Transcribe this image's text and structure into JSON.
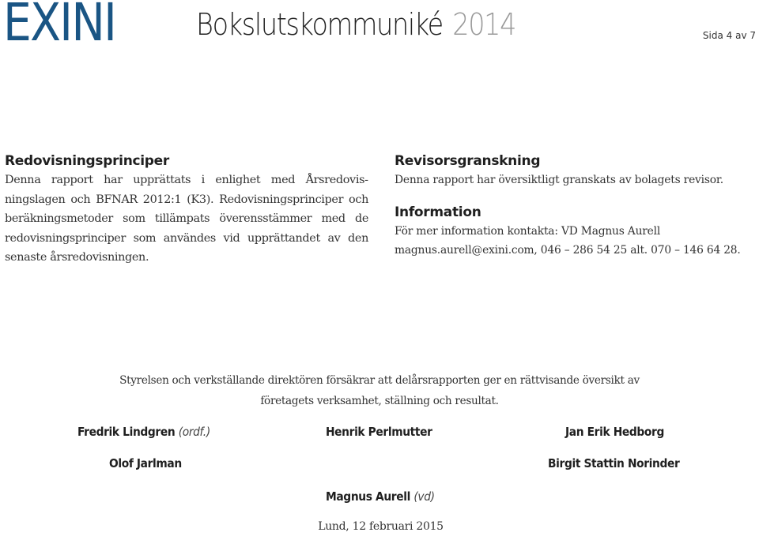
{
  "header": {
    "logo_text": "EXINI",
    "logo_color": "#1a5584",
    "document_title": "Bokslutskommuniké",
    "document_year": "2014",
    "page_indicator": "Sida 4 av 7"
  },
  "sections": {
    "accounting_principles": {
      "heading": "Redovisningsprinciper",
      "body": "Denna rapport har upprättats i enlighet med Årsredovis­ningslagen och BFNAR 2012:1 (K3). Redovisningsprinciper och beräkningsmetoder som tillämpats överensstämmer med de redovisningsprinciper som användes vid upprättandet av den senaste årsredovisningen."
    },
    "audit_review": {
      "heading": "Revisorsgranskning",
      "body": "Denna rapport har översiktligt granskats av bolagets revisor."
    },
    "information": {
      "heading": "Information",
      "line1": "För mer information kontakta: VD Magnus Aurell",
      "line2": "magnus.aurell@exini.com, 046 – 286 54 25 alt. 070 – 146 64 28."
    }
  },
  "declaration": {
    "line1": "Styrelsen och verkställande direktören försäkrar att delårsrapporten ger en rättvisande översikt av",
    "line2": "företagets verksamhet, ställning och resultat."
  },
  "signatories": [
    {
      "name": "Fredrik Lindgren",
      "role": "(ordf.)"
    },
    {
      "name": "Henrik Perlmutter",
      "role": ""
    },
    {
      "name": "Jan Erik Hedborg",
      "role": ""
    },
    {
      "name": "Olof Jarlman",
      "role": ""
    },
    {
      "name": "Birgit Stattin Norinder",
      "role": ""
    },
    {
      "name": "Magnus Aurell",
      "role": "(vd)"
    }
  ],
  "footer": {
    "place_date": "Lund, 12 februari 2015"
  }
}
